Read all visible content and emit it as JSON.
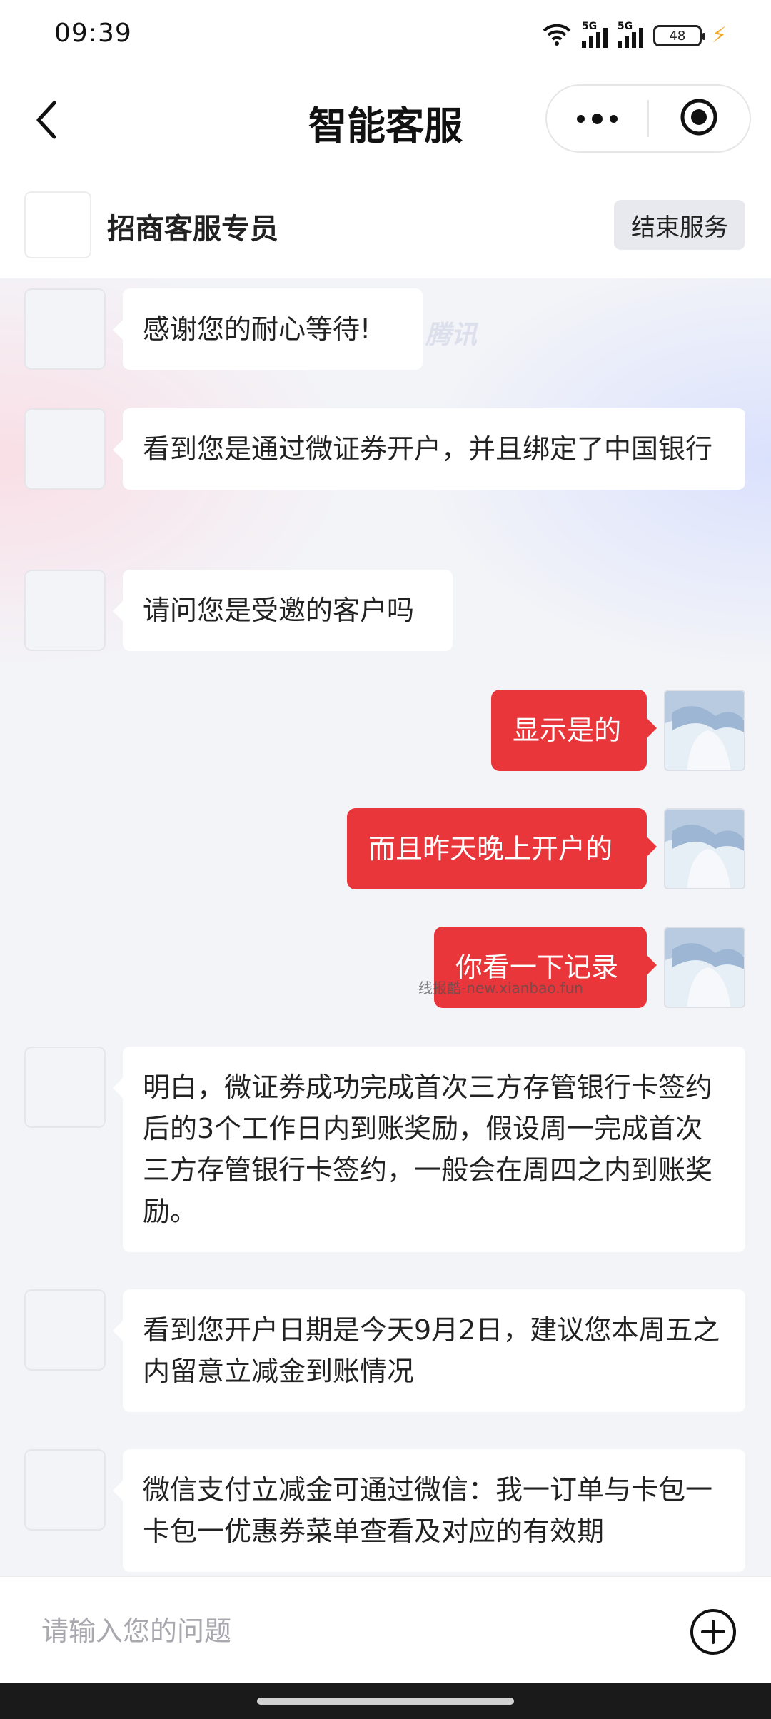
{
  "status_bar": {
    "time": "09:39",
    "signal1_tag": "5G",
    "signal2_tag": "5G",
    "battery": "48",
    "icons": [
      "wifi-icon",
      "signal-5g-icon",
      "signal-5g-icon",
      "battery-icon",
      "charging-bolt-icon"
    ]
  },
  "navbar": {
    "title": "智能客服",
    "icons": [
      "back-chevron-icon",
      "more-dots-icon",
      "close-target-icon"
    ]
  },
  "agent": {
    "name": "招商客服专员",
    "end_button": "结束服务"
  },
  "watermarks": {
    "top": "腾讯",
    "bottom": "线报酷-new.xianbao.fun"
  },
  "messages": [
    {
      "side": "left",
      "text": "感谢您的耐心等待!"
    },
    {
      "side": "left",
      "text": "看到您是通过微证券开户，并且绑定了中国银行"
    },
    {
      "side": "left",
      "text": "请问您是受邀的客户吗"
    },
    {
      "side": "right",
      "text": "显示是的"
    },
    {
      "side": "right",
      "text": "而且昨天晚上开户的"
    },
    {
      "side": "right",
      "text": "你看一下记录"
    },
    {
      "side": "left",
      "text": "明白，微证券成功完成首次三方存管银行卡签约后的3个工作日内到账奖励，假设周一完成首次三方存管银行卡签约，一般会在周四之内到账奖励。"
    },
    {
      "side": "left",
      "text": "看到您开户日期是今天9月2日，建议您本周五之内留意立减金到账情况"
    },
    {
      "side": "left",
      "text": "微信支付立减金可通过微信：我一订单与卡包一卡包一优惠券菜单查看及对应的有效期"
    }
  ],
  "input": {
    "placeholder": "请输入您的问题",
    "value": ""
  },
  "colors": {
    "accent_red": "#e8363a",
    "bubble_white": "#ffffff",
    "chat_bg": "#f3f4f8"
  }
}
